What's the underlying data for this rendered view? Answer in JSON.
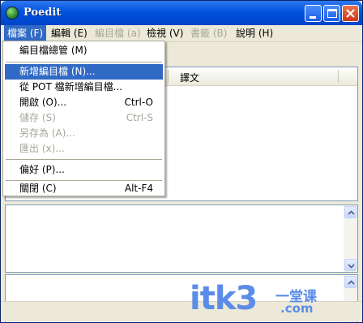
{
  "window": {
    "title": "Poedit"
  },
  "menubar": {
    "items": [
      {
        "label": "檔案 (F)"
      },
      {
        "label": "編輯 (E)"
      },
      {
        "label": "編目檔 (a)"
      },
      {
        "label": "檢視 (V)"
      },
      {
        "label": "書籤 (B)"
      },
      {
        "label": "說明 (H)"
      }
    ]
  },
  "list": {
    "columns": [
      {
        "label": "譯文"
      }
    ]
  },
  "file_menu": {
    "items": [
      {
        "label": "編目檔總管 (M)",
        "shortcut": ""
      },
      {
        "label": "新增編目檔 (N)...",
        "shortcut": ""
      },
      {
        "label": "從 POT 檔新增編目檔...",
        "shortcut": ""
      },
      {
        "label": "開啟 (O)...",
        "shortcut": "Ctrl-O"
      },
      {
        "label": "儲存 (S)",
        "shortcut": "Ctrl-S"
      },
      {
        "label": "另存為 (A)...",
        "shortcut": ""
      },
      {
        "label": "匯出 (x)...",
        "shortcut": ""
      },
      {
        "label": "偏好 (P)...",
        "shortcut": ""
      },
      {
        "label": "關閉 (C)",
        "shortcut": "Alt-F4"
      }
    ]
  },
  "watermark": {
    "text": "itk3",
    "sub": "一堂课",
    "domain": ".com"
  }
}
